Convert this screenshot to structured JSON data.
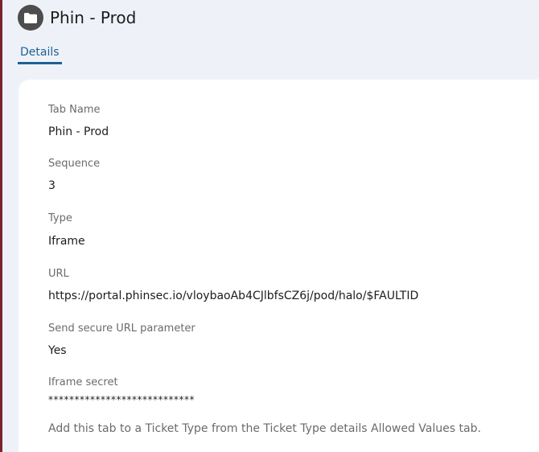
{
  "header": {
    "icon": "folder-icon",
    "title": "Phin - Prod"
  },
  "tabs": [
    {
      "label": "Details",
      "active": true
    }
  ],
  "details": {
    "tab_name": {
      "label": "Tab Name",
      "value": "Phin - Prod"
    },
    "sequence": {
      "label": "Sequence",
      "value": "3"
    },
    "type": {
      "label": "Type",
      "value": "Iframe"
    },
    "url": {
      "label": "URL",
      "value": "https://portal.phinsec.io/vloybaoAb4CJlbfsCZ6j/pod/halo/$FAULTID"
    },
    "send_secure_url": {
      "label": "Send secure URL parameter",
      "value": "Yes"
    },
    "iframe_secret": {
      "label": "Iframe secret",
      "value": "****************************"
    },
    "hint": "Add this tab to a Ticket Type from the Ticket Type details Allowed Values tab."
  },
  "colors": {
    "accent": "#1f5f96",
    "page_background": "#eef2f8",
    "left_rule": "#7a2330"
  }
}
